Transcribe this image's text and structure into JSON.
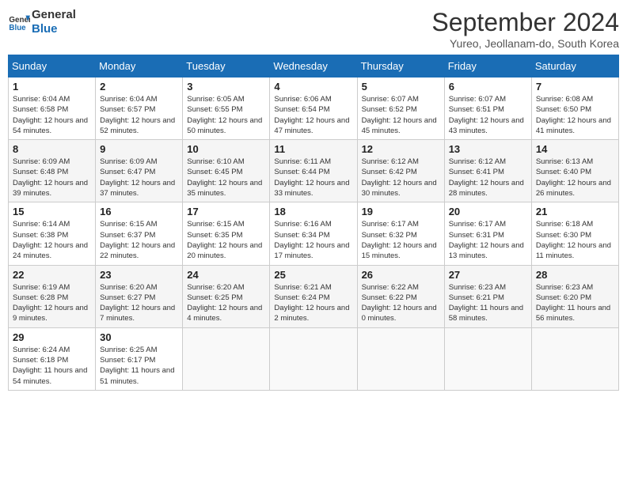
{
  "header": {
    "logo_line1": "General",
    "logo_line2": "Blue",
    "month_title": "September 2024",
    "location": "Yureo, Jeollanam-do, South Korea"
  },
  "days_of_week": [
    "Sunday",
    "Monday",
    "Tuesday",
    "Wednesday",
    "Thursday",
    "Friday",
    "Saturday"
  ],
  "weeks": [
    [
      {
        "day": "1",
        "sunrise": "6:04 AM",
        "sunset": "6:58 PM",
        "daylight": "12 hours and 54 minutes."
      },
      {
        "day": "2",
        "sunrise": "6:04 AM",
        "sunset": "6:57 PM",
        "daylight": "12 hours and 52 minutes."
      },
      {
        "day": "3",
        "sunrise": "6:05 AM",
        "sunset": "6:55 PM",
        "daylight": "12 hours and 50 minutes."
      },
      {
        "day": "4",
        "sunrise": "6:06 AM",
        "sunset": "6:54 PM",
        "daylight": "12 hours and 47 minutes."
      },
      {
        "day": "5",
        "sunrise": "6:07 AM",
        "sunset": "6:52 PM",
        "daylight": "12 hours and 45 minutes."
      },
      {
        "day": "6",
        "sunrise": "6:07 AM",
        "sunset": "6:51 PM",
        "daylight": "12 hours and 43 minutes."
      },
      {
        "day": "7",
        "sunrise": "6:08 AM",
        "sunset": "6:50 PM",
        "daylight": "12 hours and 41 minutes."
      }
    ],
    [
      {
        "day": "8",
        "sunrise": "6:09 AM",
        "sunset": "6:48 PM",
        "daylight": "12 hours and 39 minutes."
      },
      {
        "day": "9",
        "sunrise": "6:09 AM",
        "sunset": "6:47 PM",
        "daylight": "12 hours and 37 minutes."
      },
      {
        "day": "10",
        "sunrise": "6:10 AM",
        "sunset": "6:45 PM",
        "daylight": "12 hours and 35 minutes."
      },
      {
        "day": "11",
        "sunrise": "6:11 AM",
        "sunset": "6:44 PM",
        "daylight": "12 hours and 33 minutes."
      },
      {
        "day": "12",
        "sunrise": "6:12 AM",
        "sunset": "6:42 PM",
        "daylight": "12 hours and 30 minutes."
      },
      {
        "day": "13",
        "sunrise": "6:12 AM",
        "sunset": "6:41 PM",
        "daylight": "12 hours and 28 minutes."
      },
      {
        "day": "14",
        "sunrise": "6:13 AM",
        "sunset": "6:40 PM",
        "daylight": "12 hours and 26 minutes."
      }
    ],
    [
      {
        "day": "15",
        "sunrise": "6:14 AM",
        "sunset": "6:38 PM",
        "daylight": "12 hours and 24 minutes."
      },
      {
        "day": "16",
        "sunrise": "6:15 AM",
        "sunset": "6:37 PM",
        "daylight": "12 hours and 22 minutes."
      },
      {
        "day": "17",
        "sunrise": "6:15 AM",
        "sunset": "6:35 PM",
        "daylight": "12 hours and 20 minutes."
      },
      {
        "day": "18",
        "sunrise": "6:16 AM",
        "sunset": "6:34 PM",
        "daylight": "12 hours and 17 minutes."
      },
      {
        "day": "19",
        "sunrise": "6:17 AM",
        "sunset": "6:32 PM",
        "daylight": "12 hours and 15 minutes."
      },
      {
        "day": "20",
        "sunrise": "6:17 AM",
        "sunset": "6:31 PM",
        "daylight": "12 hours and 13 minutes."
      },
      {
        "day": "21",
        "sunrise": "6:18 AM",
        "sunset": "6:30 PM",
        "daylight": "12 hours and 11 minutes."
      }
    ],
    [
      {
        "day": "22",
        "sunrise": "6:19 AM",
        "sunset": "6:28 PM",
        "daylight": "12 hours and 9 minutes."
      },
      {
        "day": "23",
        "sunrise": "6:20 AM",
        "sunset": "6:27 PM",
        "daylight": "12 hours and 7 minutes."
      },
      {
        "day": "24",
        "sunrise": "6:20 AM",
        "sunset": "6:25 PM",
        "daylight": "12 hours and 4 minutes."
      },
      {
        "day": "25",
        "sunrise": "6:21 AM",
        "sunset": "6:24 PM",
        "daylight": "12 hours and 2 minutes."
      },
      {
        "day": "26",
        "sunrise": "6:22 AM",
        "sunset": "6:22 PM",
        "daylight": "12 hours and 0 minutes."
      },
      {
        "day": "27",
        "sunrise": "6:23 AM",
        "sunset": "6:21 PM",
        "daylight": "11 hours and 58 minutes."
      },
      {
        "day": "28",
        "sunrise": "6:23 AM",
        "sunset": "6:20 PM",
        "daylight": "11 hours and 56 minutes."
      }
    ],
    [
      {
        "day": "29",
        "sunrise": "6:24 AM",
        "sunset": "6:18 PM",
        "daylight": "11 hours and 54 minutes."
      },
      {
        "day": "30",
        "sunrise": "6:25 AM",
        "sunset": "6:17 PM",
        "daylight": "11 hours and 51 minutes."
      },
      null,
      null,
      null,
      null,
      null
    ]
  ]
}
